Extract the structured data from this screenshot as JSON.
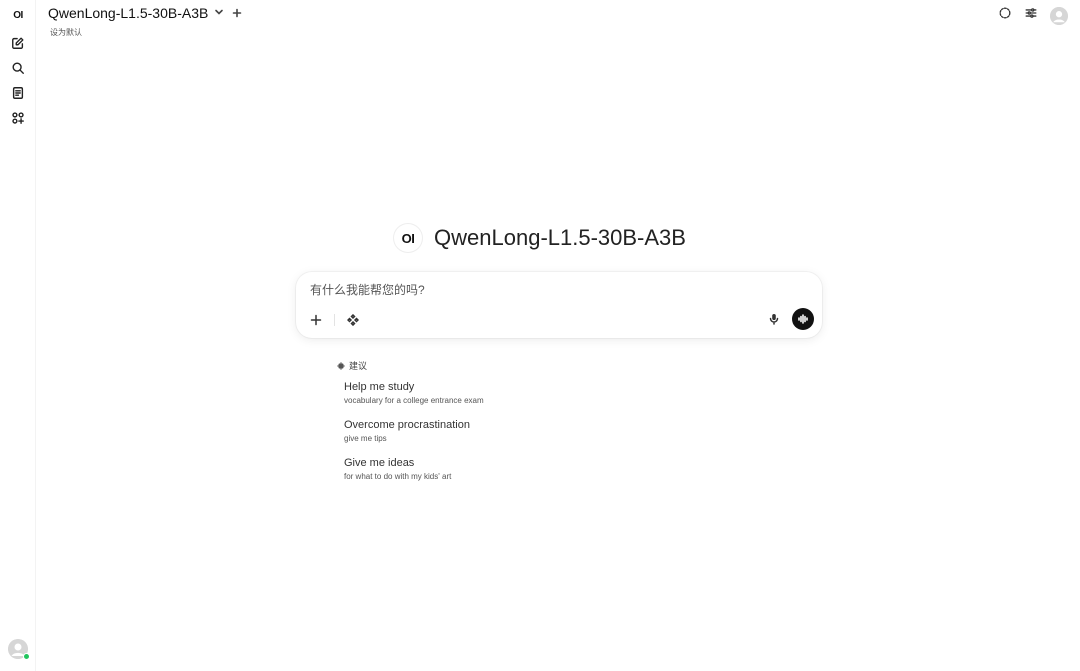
{
  "sidebar": {
    "logo_text": "OI",
    "items": [
      {
        "name": "new-chat",
        "icon": "pencil-square-icon"
      },
      {
        "name": "search",
        "icon": "search-icon"
      },
      {
        "name": "notes",
        "icon": "notes-icon"
      },
      {
        "name": "workspace",
        "icon": "grid-icon"
      }
    ],
    "status_color": "#22c55e"
  },
  "header": {
    "model_name": "QwenLong-L1.5-30B-A3B",
    "set_default": "设为默认"
  },
  "hero": {
    "logo_text": "OI",
    "title": "QwenLong-L1.5-30B-A3B"
  },
  "prompt": {
    "placeholder": "有什么我能帮您的吗?"
  },
  "suggestions": {
    "heading": "建议",
    "items": [
      {
        "title": "Help me study",
        "subtitle": "vocabulary for a college entrance exam"
      },
      {
        "title": "Overcome procrastination",
        "subtitle": "give me tips"
      },
      {
        "title": "Give me ideas",
        "subtitle": "for what to do with my kids' art"
      }
    ]
  },
  "colors": {
    "accent": "#111111",
    "background": "#ffffff"
  }
}
